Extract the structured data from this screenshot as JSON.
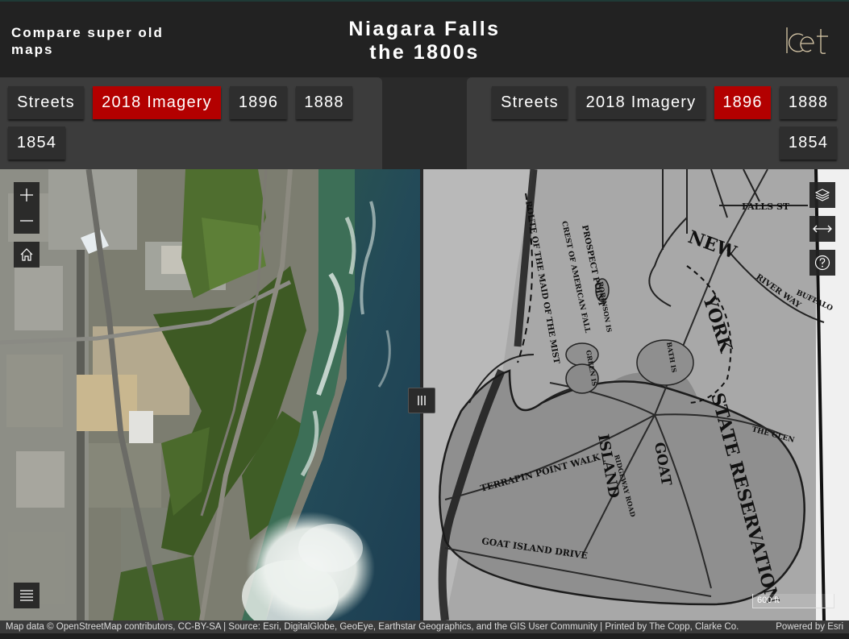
{
  "header": {
    "app_title": "Compare super old maps",
    "title_line1": "Niagara Falls",
    "title_line2": "the 1800s",
    "logo_text": "lcet"
  },
  "left_panel": {
    "buttons": [
      {
        "label": "Streets",
        "active": false
      },
      {
        "label": "2018 Imagery",
        "active": true
      },
      {
        "label": "1896",
        "active": false
      },
      {
        "label": "1888",
        "active": false
      },
      {
        "label": "1854",
        "active": false
      }
    ]
  },
  "right_panel": {
    "buttons": [
      {
        "label": "Streets",
        "active": false
      },
      {
        "label": "2018 Imagery",
        "active": false
      },
      {
        "label": "1896",
        "active": true
      },
      {
        "label": "1888",
        "active": false
      },
      {
        "label": "1854",
        "active": false
      }
    ]
  },
  "map_labels": {
    "falls_st": "FALLS ST",
    "new": "NEW",
    "york": "YORK",
    "state_reservation": "STATE RESERVATION",
    "goat": "GOAT",
    "island": "ISLAND",
    "terrapin": "TERRAPIN POINT WALK",
    "goat_island_drive": "GOAT ISLAND DRIVE",
    "prospect_point": "PROSPECT POINT",
    "crest": "CREST OF AMERICAN FALL",
    "route": "ROUTE OF THE MAID OF THE MIST",
    "river_way": "RIVER WAY",
    "buffalo": "BUFFALO",
    "the_glen": "THE GLEN",
    "riverway_road": "RIDGEWAY ROAD",
    "bath": "BATH IS",
    "green": "GREEN IS",
    "robinson": "ROBINSON IS"
  },
  "colors": {
    "active": "#b30000",
    "button": "#2e2e2e",
    "panel": "#3c3c3c",
    "header": "#222222"
  },
  "icons": {
    "zoom_in": "plus-icon",
    "zoom_out": "minus-icon",
    "home": "home-icon",
    "layers": "layers-icon",
    "swipe": "swipe-arrows-icon",
    "help": "help-icon",
    "legend": "list-icon",
    "divider": "divider-grip-icon"
  },
  "scalebar": {
    "label": "600 ft"
  },
  "attribution": {
    "text": "Map data © OpenStreetMap contributors, CC-BY-SA | Source: Esri, DigitalGlobe, GeoEye, Earthstar Geographics, and the GIS User Community | Printed by The Copp, Clarke Co.",
    "powered": "Powered by Esri"
  }
}
